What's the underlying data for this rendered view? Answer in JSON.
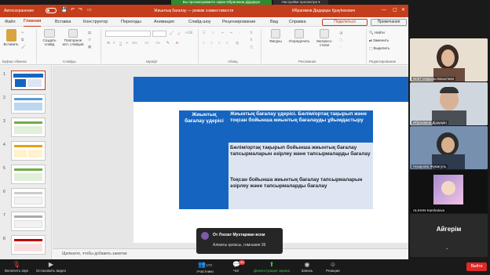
{
  "zoom": {
    "share_banner": "Вы просматриваете экран Ибрагимов Дідарқан",
    "view_options": "Настройки просмотра ▾",
    "bottom": {
      "mic_label": "Включить звук",
      "video_label": "Остановить видео",
      "participants_label": "Участники",
      "participants_count": "173",
      "chat_label": "Чат",
      "chat_badge": "34",
      "share_label": "Демонстрация экрана",
      "record_label": "Запись",
      "reactions_label": "Реакции",
      "leave_label": "Выйти"
    },
    "toast": {
      "title": "От Ләззат Мухтаржан всем",
      "message": "Алматы қаласы, гимназия 36"
    },
    "participants": [
      {
        "name": "N037 сеңкызы Бахытжан"
      },
      {
        "name": "Ибрагимов Дідарқан"
      },
      {
        "name": "Назарова Жумагуль"
      },
      {
        "name": "ALIHAN Karshalova"
      },
      {
        "name": "Айгерім"
      }
    ]
  },
  "ppt": {
    "autosave_label": "Автосохранение",
    "autosave_state": "●",
    "title": "Жиынтық бағалау — режим совместимости",
    "user": "Ибрагимов Дидарқан Қрауһекович",
    "tabs": [
      "Файл",
      "Главная",
      "Вставка",
      "Конструктор",
      "Переходы",
      "Анимация",
      "Слайд-шоу",
      "Рецензирование",
      "Вид",
      "Справка"
    ],
    "active_tab": "Главная",
    "share_btn": "Поделиться",
    "comments_btn": "Примечания",
    "ribbon": {
      "paste": "Вставить",
      "clipboard_group": "Буфер обмена",
      "new_slide": "Создать слайд",
      "reuse_slides": "Повторное исп. слайдов",
      "slides_group": "Слайды",
      "font_group": "Шрифт",
      "paragraph_group": "Абзац",
      "shapes": "Фигуры",
      "arrange": "Упорядочить",
      "styles": "Экспресс-стили",
      "drawing_group": "Рисование",
      "find": "Найти",
      "replace": "Заменить",
      "select": "Выделить",
      "editing_group": "Редактирование"
    },
    "thumbnail_numbers": [
      "1",
      "2",
      "3",
      "4",
      "5",
      "6",
      "7",
      "8"
    ],
    "notes_placeholder": "Щелкните, чтобы добавить заметки",
    "slide": {
      "left_header": "Жиынтық бағалау үдерісі",
      "cell1": "Жиынтық бағалау үдерісі. Бөлім/ортақ тақырып және тоқсан бойынша жиынтық бағалауды ұйымдастыру",
      "cell2": "Бөлім/ортақ тақырып бойынша жиынтық бағалау тапсырмаларын әзірлеу және тапсырмаларды бағалау",
      "cell3": "Тоқсан бойынша жиынтық бағалау тапсырмаларын әзірлеу және тапсырмаларды бағалау"
    }
  }
}
